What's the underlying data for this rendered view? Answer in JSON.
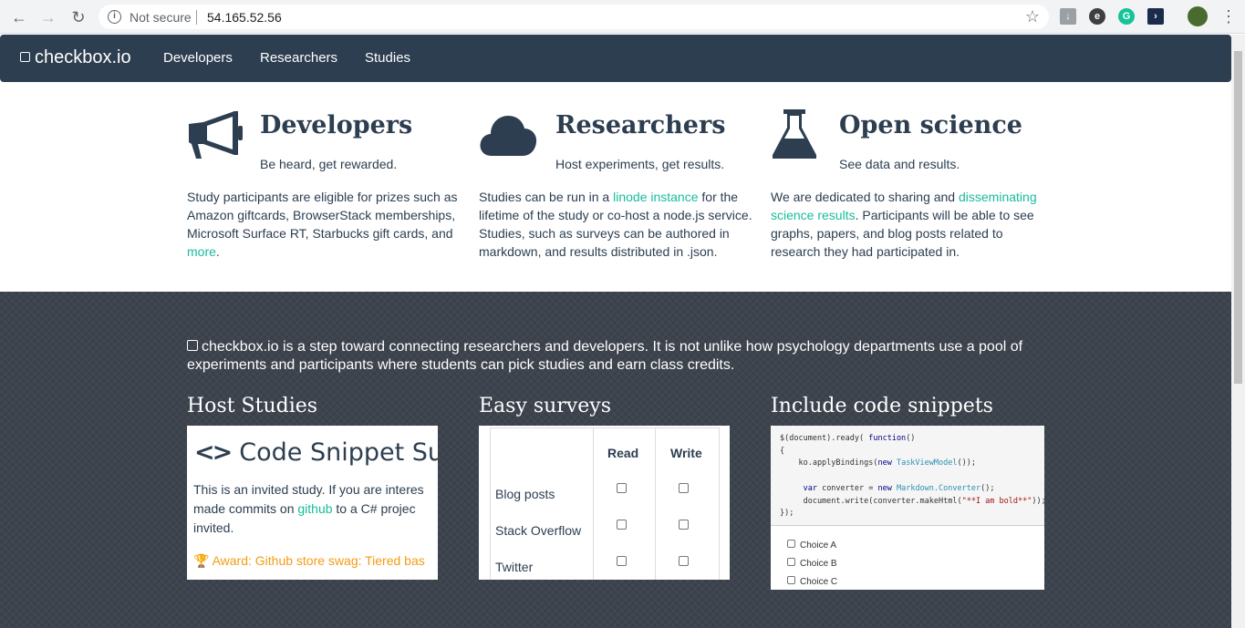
{
  "browser": {
    "security_label": "Not secure",
    "url": "54.165.52.56"
  },
  "navbar": {
    "brand": "checkbox.io",
    "links": [
      "Developers",
      "Researchers",
      "Studies"
    ]
  },
  "features": [
    {
      "title": "Developers",
      "tagline": "Be heard, get rewarded.",
      "desc_pre": "Study participants are eligible for prizes such as Amazon giftcards, BrowserStack memberships, Microsoft Surface RT, Starbucks gift cards, and ",
      "link": "more",
      "desc_post": "."
    },
    {
      "title": "Researchers",
      "tagline": "Host experiments, get results.",
      "desc_pre": "Studies can be run in a ",
      "link": "linode instance",
      "desc_post": " for the lifetime of the study or co-host a node.js service. Studies, such as surveys can be authored in markdown, and results distributed in .json."
    },
    {
      "title": "Open science",
      "tagline": "See data and results.",
      "desc_pre": "We are dedicated to sharing and ",
      "link": "disseminating science results",
      "desc_post": ". Participants will be able to see graphs, papers, and blog posts related to research they had participated in."
    }
  ],
  "intro": {
    "text": "checkbox.io is a step toward connecting researchers and developers. It is not unlike how psychology departments use a pool of experiments and participants where students can pick studies and earn class credits."
  },
  "sections": {
    "host": {
      "heading": "Host Studies",
      "title": "Code Snippet Su",
      "body_pre": "This is an invited study. If you are interes",
      "body_mid1": "made commits on ",
      "body_link": "github",
      "body_mid2": " to a C# projec",
      "body_end": "invited.",
      "award": "Award: Github store swag: Tiered bas"
    },
    "survey": {
      "heading": "Easy surveys",
      "columns": [
        "Read",
        "Write"
      ],
      "rows": [
        "Blog posts",
        "Stack Overflow",
        "Twitter"
      ]
    },
    "code": {
      "heading": "Include code snippets",
      "choices": [
        "Choice A",
        "Choice B",
        "Choice C"
      ]
    }
  }
}
